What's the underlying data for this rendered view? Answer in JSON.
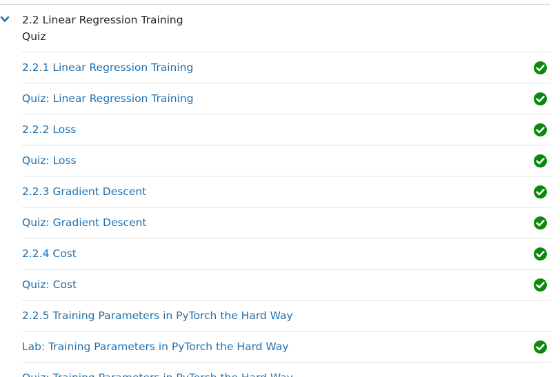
{
  "section": {
    "title": "2.2 Linear Regression Training",
    "subtitle": "Quiz",
    "expand_icon": "chevron-down-icon",
    "accent_color": "#1f6fab"
  },
  "status_icon": "check-circle-icon",
  "status_color": "#0a8a0a",
  "items": [
    {
      "label": "2.2.1 Linear Regression Training",
      "completed": true
    },
    {
      "label": "Quiz: Linear Regression Training",
      "completed": true
    },
    {
      "label": "2.2.2 Loss",
      "completed": true
    },
    {
      "label": "Quiz: Loss",
      "completed": true
    },
    {
      "label": "2.2.3 Gradient Descent",
      "completed": true
    },
    {
      "label": "Quiz: Gradient Descent",
      "completed": true
    },
    {
      "label": "2.2.4 Cost",
      "completed": true
    },
    {
      "label": "Quiz: Cost",
      "completed": true
    },
    {
      "label": "2.2.5 Training Parameters in PyTorch the Hard Way",
      "completed": false
    },
    {
      "label": "Lab: Training Parameters in PyTorch the Hard Way",
      "completed": true
    },
    {
      "label": "Quiz: Training Parameters in PyTorch the Hard Way",
      "completed": false
    }
  ]
}
